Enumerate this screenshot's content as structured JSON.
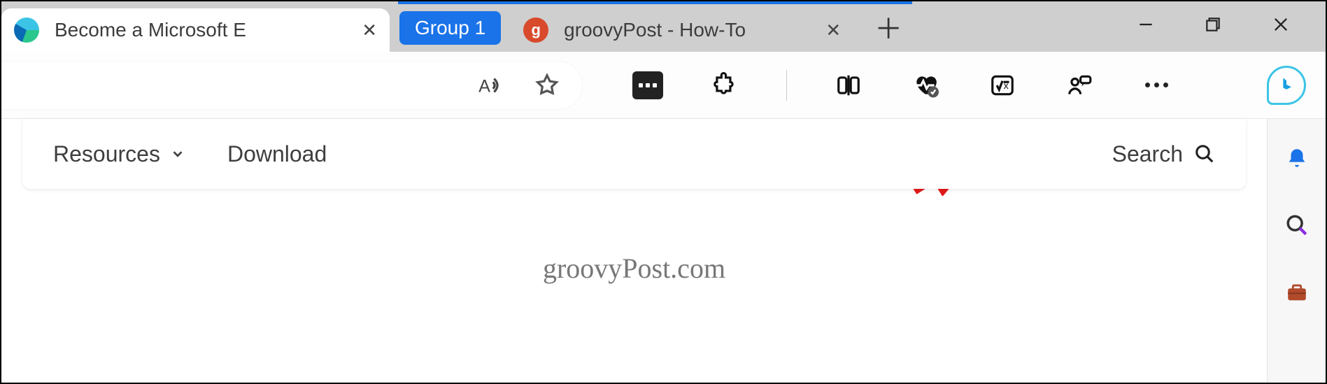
{
  "tabs": {
    "active": {
      "title": "Become a Microsoft E",
      "favicon": "edge"
    },
    "group_label": "Group 1",
    "second": {
      "title": "groovyPost - How-To",
      "favicon": "groovypost",
      "favicon_letter": "g"
    }
  },
  "window_controls": {
    "minimize": "minimize",
    "restore": "restore",
    "close": "close"
  },
  "toolbar_icons": {
    "read_aloud": "read-aloud",
    "favorite": "favorite-star",
    "ext_password": "password-extension",
    "extensions": "extensions-puzzle",
    "split_screen": "split-screen",
    "performance": "browser-essentials-heart",
    "math_solver": "math-solver",
    "feedback": "feedback-person",
    "more": "settings-more",
    "bing": "bing-chat"
  },
  "page": {
    "resources": "Resources",
    "download": "Download",
    "search": "Search",
    "watermark": "groovyPost.com"
  },
  "sidebar": {
    "notifications": "notifications-bell",
    "search": "search-magnifier",
    "tools": "tools-briefcase"
  },
  "annotation": {
    "arrow": "pointer-arrow"
  }
}
